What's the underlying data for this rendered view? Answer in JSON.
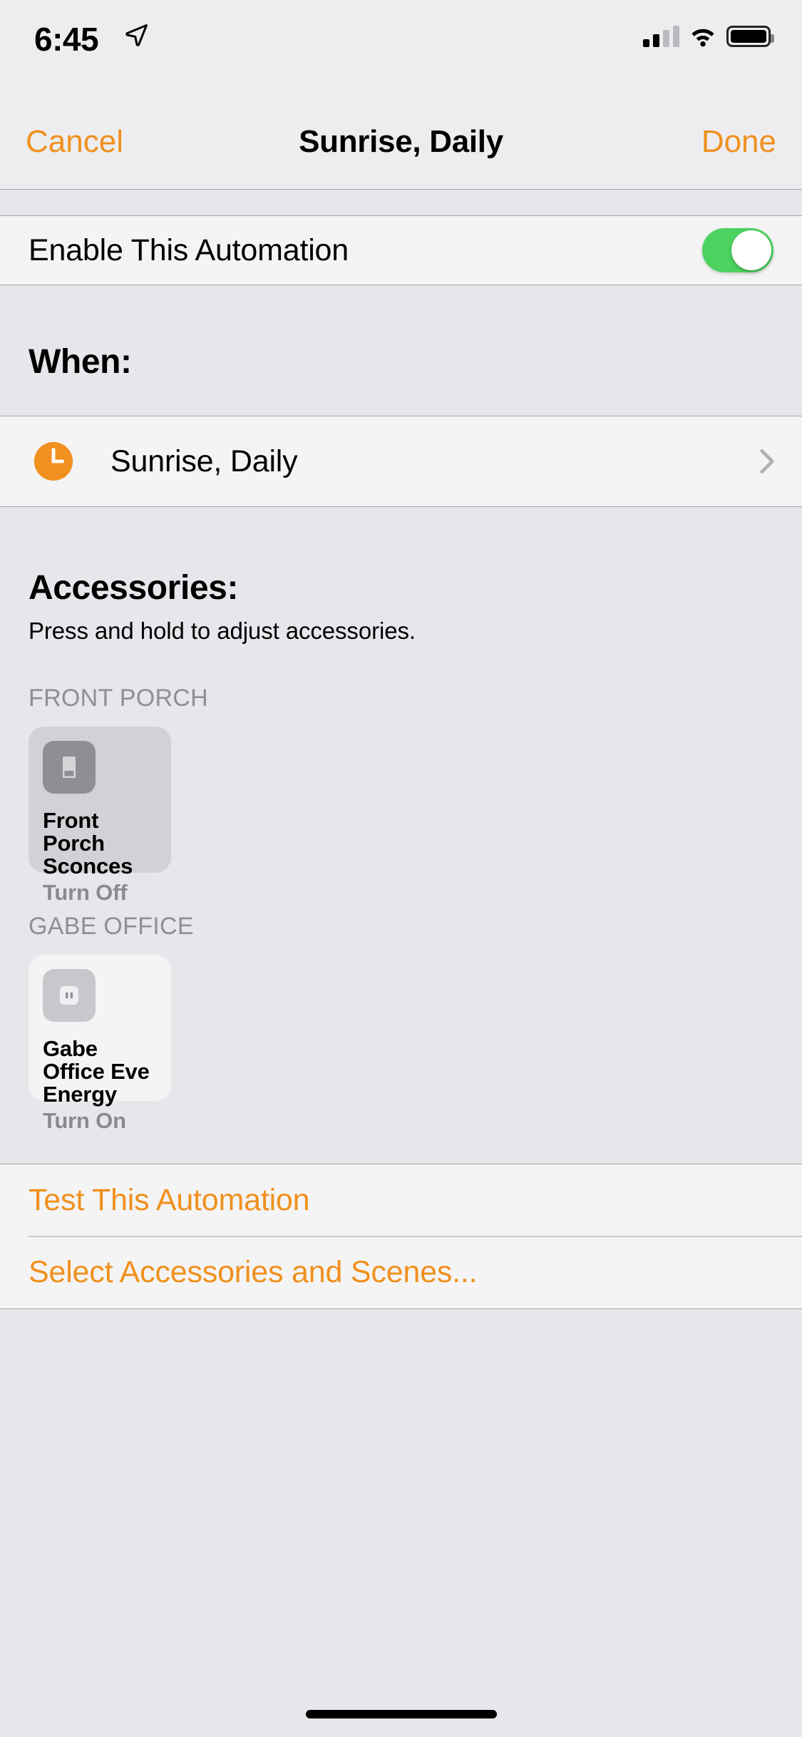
{
  "status_bar": {
    "time": "6:45",
    "location_icon": "location-arrow-icon",
    "cellular_icon": "cellular-signal-icon",
    "cellular_bars_filled": 2,
    "cellular_bars_total": 4,
    "wifi_icon": "wifi-icon",
    "battery_icon": "battery-full-icon"
  },
  "nav_bar": {
    "cancel_label": "Cancel",
    "title": "Sunrise, Daily",
    "done_label": "Done"
  },
  "enable_section": {
    "label": "Enable This Automation",
    "toggle_state": "on",
    "toggle_color": "#4CD35F"
  },
  "when_section": {
    "header": "When:",
    "trigger": {
      "icon": "clock-icon",
      "icon_color": "#F0901E",
      "label": "Sunrise, Daily",
      "disclosure_icon": "chevron-right-icon"
    }
  },
  "accessories_section": {
    "header": "Accessories:",
    "subtitle": "Press and hold to adjust accessories.",
    "rooms": [
      {
        "name": "FRONT PORCH",
        "accessories": [
          {
            "name": "Front Porch Sconces",
            "state": "Turn Off",
            "icon": "light-switch-icon",
            "tile_style": "off",
            "tile_color": "#D1D1D6"
          }
        ]
      },
      {
        "name": "GABE OFFICE",
        "accessories": [
          {
            "name": "Gabe Office Eve Energy",
            "state": "Turn On",
            "icon": "power-outlet-icon",
            "tile_style": "on",
            "tile_color": "#F4F4F4"
          }
        ]
      }
    ]
  },
  "actions": [
    {
      "label": "Test This Automation"
    },
    {
      "label": "Select Accessories and Scenes..."
    }
  ],
  "accent_color": "#F0901E",
  "home_indicator": "home-indicator"
}
